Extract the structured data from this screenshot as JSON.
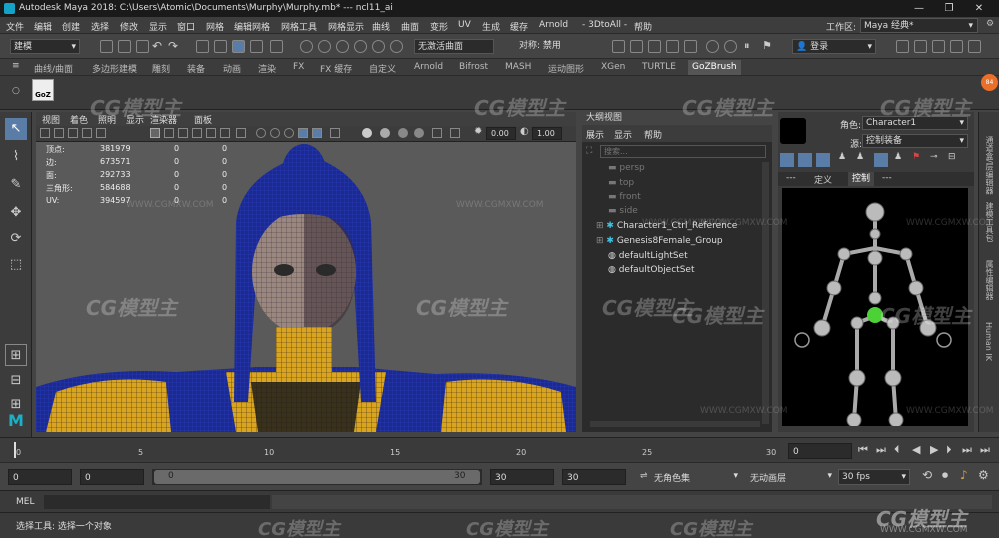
{
  "titlebar": {
    "title": "Autodesk Maya 2018: C:\\Users\\Atomic\\Documents\\Murphy\\Murphy.mb*   ---   ncl11_ai",
    "minimize": "—",
    "restore": "❐",
    "close": "✕"
  },
  "menubar": {
    "items": [
      "文件",
      "编辑",
      "创建",
      "选择",
      "修改",
      "显示",
      "窗口",
      "网格",
      "编辑网格",
      "网格工具",
      "网格显示",
      "曲线",
      "曲面",
      "变形",
      "UV",
      "生成",
      "缓存",
      "Arnold",
      "- 3DtoAll -",
      "帮助"
    ],
    "workspace_label": "工作区:",
    "workspace_value": "Maya 经典*"
  },
  "toolbar": {
    "mode": "建模",
    "live_surface": "无激活曲面",
    "symmetry_label": "对称: 禁用",
    "login": "登录"
  },
  "shelf": {
    "tabs": [
      "曲线/曲面",
      "多边形建模",
      "雕刻",
      "装备",
      "动画",
      "渲染",
      "FX",
      "FX 缓存",
      "自定义",
      "Arnold",
      "Bifrost",
      "MASH",
      "运动图形",
      "XGen",
      "TURTLE",
      "GoZBrush"
    ],
    "active_tab": "GoZBrush",
    "goz_label": "GoZ"
  },
  "viewport": {
    "menu": [
      "视图",
      "着色",
      "照明",
      "显示",
      "渲染器",
      "面板"
    ],
    "exposure": "0.00",
    "gamma": "1.00",
    "hud": [
      {
        "label": "顶点:",
        "a": "381979",
        "b": "0",
        "c": "0"
      },
      {
        "label": "边:",
        "a": "673571",
        "b": "0",
        "c": "0"
      },
      {
        "label": "面:",
        "a": "292733",
        "b": "0",
        "c": "0"
      },
      {
        "label": "三角形:",
        "a": "584688",
        "b": "0",
        "c": "0"
      },
      {
        "label": "UV:",
        "a": "394597",
        "b": "0",
        "c": "0"
      }
    ]
  },
  "outliner": {
    "title": "大纲视图",
    "menu": [
      "展示",
      "显示",
      "帮助"
    ],
    "search_placeholder": "搜索...",
    "cameras": [
      "persp",
      "top",
      "front",
      "side"
    ],
    "items": [
      "Character1_Ctrl_Reference",
      "Genesis8Female_Group",
      "defaultLightSet",
      "defaultObjectSet"
    ]
  },
  "hik": {
    "character_label": "角色:",
    "character_value": "Character1",
    "source_label": "源:",
    "source_value": "控制装备",
    "tabs": [
      "---",
      "定义",
      "控制",
      "---"
    ],
    "active_tab": "控制"
  },
  "sidetabs": [
    "通道盒/层编辑器",
    "建模工具包",
    "属性编辑器",
    "Human IK"
  ],
  "timeslider": {
    "ticks": [
      "0",
      "5",
      "10",
      "15",
      "20",
      "25",
      "30"
    ],
    "current_frame": "0"
  },
  "rangebar": {
    "start": "0",
    "playback_start": "0",
    "range_min": "0",
    "range_max": "30",
    "playback_end": "30",
    "end": "30",
    "char_set": "无角色集",
    "anim_layer": "无动画层",
    "fps": "30 fps"
  },
  "mel": {
    "label": "MEL"
  },
  "status": {
    "text": "选择工具: 选择一个对象"
  },
  "watermark": {
    "logo": "CG模型主",
    "url": "WWW.CGMXW.COM"
  },
  "colors": {
    "accent_blue": "#4a8fd6",
    "hik_active": "#4cd137",
    "mesh_blue": "#1e2f9a",
    "mesh_yellow": "#e0b020"
  }
}
